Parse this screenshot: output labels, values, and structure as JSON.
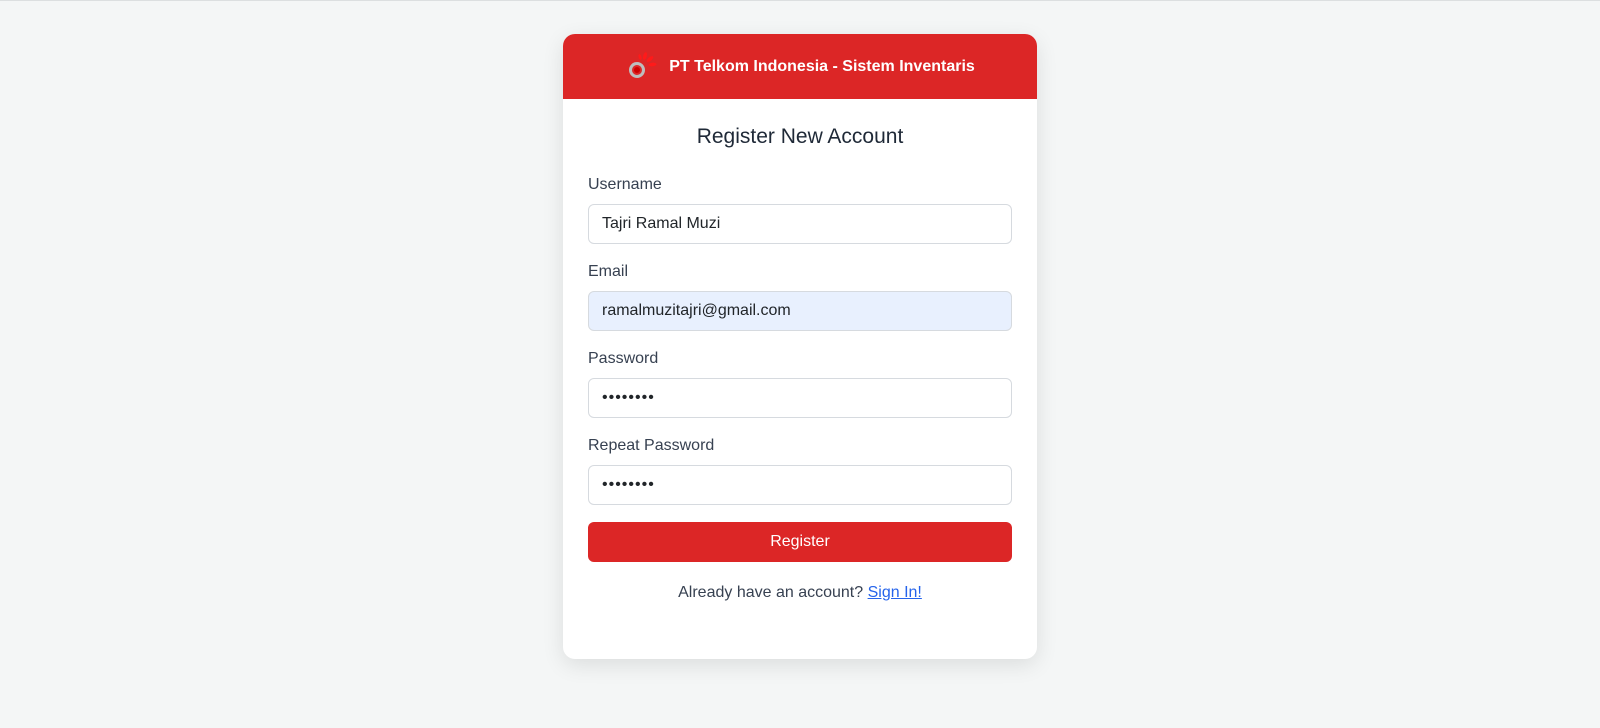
{
  "header": {
    "logo_icon": "telkom-logo-icon",
    "title": "PT Telkom Indonesia - Sistem Inventaris",
    "accent_color": "#dc2626"
  },
  "form": {
    "title": "Register New Account",
    "username": {
      "label": "Username",
      "value": "Tajri Ramal Muzi"
    },
    "email": {
      "label": "Email",
      "value": "ramalmuzitajri@gmail.com"
    },
    "password": {
      "label": "Password",
      "value": "••••••••"
    },
    "repeat_password": {
      "label": "Repeat Password",
      "value": "••••••••"
    },
    "submit_label": "Register"
  },
  "footer": {
    "prompt": "Already have an account?",
    "link_label": "Sign In!"
  }
}
